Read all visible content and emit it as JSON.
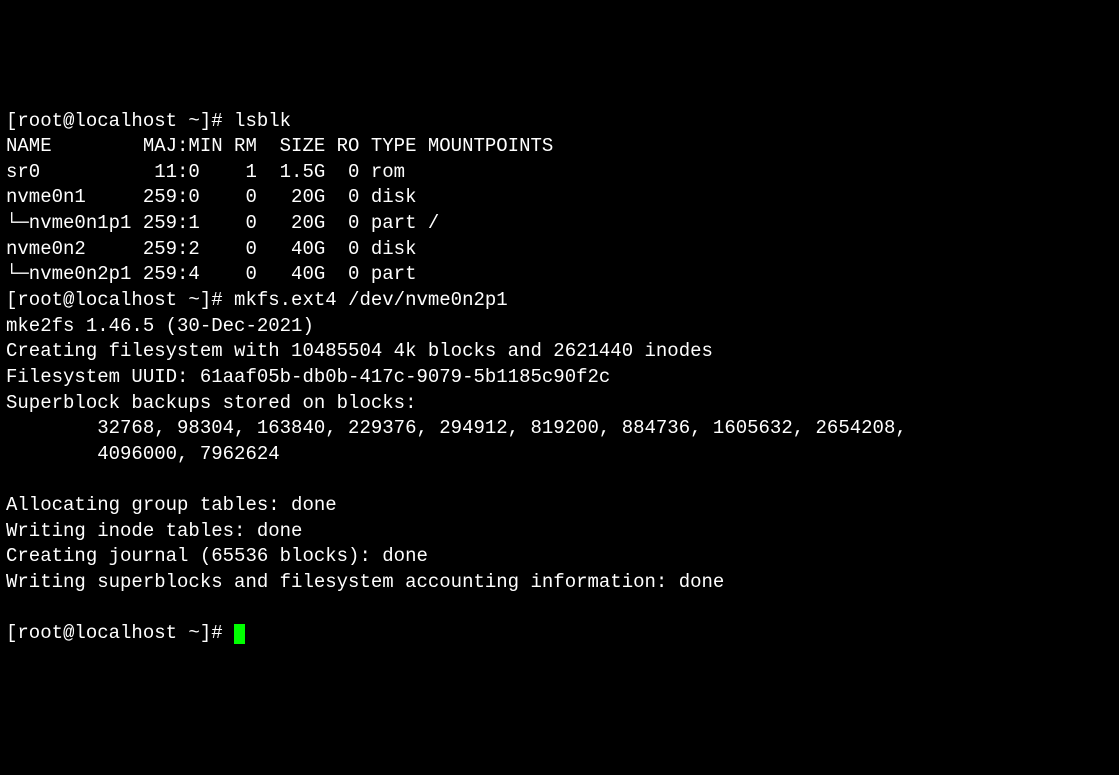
{
  "prompt1": "[root@localhost ~]# ",
  "cmd1": "lsblk",
  "header": "NAME        MAJ:MIN RM  SIZE RO TYPE MOUNTPOINTS",
  "row1": "sr0          11:0    1  1.5G  0 rom",
  "row2": "nvme0n1     259:0    0   20G  0 disk",
  "row3": "└─nvme0n1p1 259:1    0   20G  0 part /",
  "row4": "nvme0n2     259:2    0   40G  0 disk",
  "row5": "└─nvme0n2p1 259:4    0   40G  0 part",
  "prompt2": "[root@localhost ~]# ",
  "cmd2": "mkfs.ext4 /dev/nvme0n2p1",
  "out1": "mke2fs 1.46.5 (30-Dec-2021)",
  "out2": "Creating filesystem with 10485504 4k blocks and 2621440 inodes",
  "out3": "Filesystem UUID: 61aaf05b-db0b-417c-9079-5b1185c90f2c",
  "out4": "Superblock backups stored on blocks:",
  "out5": "        32768, 98304, 163840, 229376, 294912, 819200, 884736, 1605632, 2654208,",
  "out6": "        4096000, 7962624",
  "blank1": "",
  "out7": "Allocating group tables: done",
  "out8": "Writing inode tables: done",
  "out9": "Creating journal (65536 blocks): done",
  "out10": "Writing superblocks and filesystem accounting information: done",
  "blank2": "",
  "prompt3": "[root@localhost ~]# "
}
